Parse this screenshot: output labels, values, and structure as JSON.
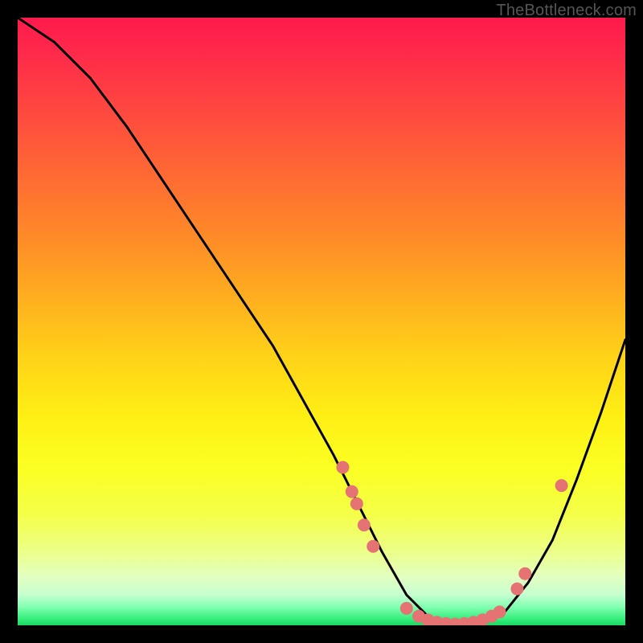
{
  "watermark": "TheBottleneck.com",
  "chart_data": {
    "type": "line",
    "title": "",
    "xlabel": "",
    "ylabel": "",
    "xlim": [
      0,
      100
    ],
    "ylim": [
      0,
      100
    ],
    "series": [
      {
        "name": "curve",
        "x": [
          0,
          6,
          12,
          18,
          24,
          30,
          36,
          42,
          47,
          52,
          56,
          60,
          64,
          68,
          72,
          76,
          80,
          84,
          88,
          92,
          96,
          100
        ],
        "y": [
          100,
          96,
          90,
          82,
          73,
          64,
          55,
          46,
          37,
          28,
          20,
          12,
          5,
          1,
          0,
          0,
          2,
          7,
          14,
          24,
          35,
          47
        ]
      }
    ],
    "points": {
      "name": "data-points",
      "color": "#e57373",
      "radius_px": 8,
      "xy": [
        [
          53.5,
          26
        ],
        [
          55.0,
          22
        ],
        [
          55.8,
          20
        ],
        [
          57.0,
          16.5
        ],
        [
          58.5,
          13
        ],
        [
          64.0,
          2.8
        ],
        [
          66.0,
          1.5
        ],
        [
          67.5,
          0.9
        ],
        [
          69.0,
          0.5
        ],
        [
          70.5,
          0.3
        ],
        [
          72.0,
          0.2
        ],
        [
          73.5,
          0.3
        ],
        [
          75.0,
          0.5
        ],
        [
          76.5,
          0.9
        ],
        [
          78.0,
          1.5
        ],
        [
          79.3,
          2.2
        ],
        [
          82.2,
          6.0
        ],
        [
          83.5,
          8.5
        ],
        [
          89.5,
          23.0
        ]
      ]
    }
  }
}
